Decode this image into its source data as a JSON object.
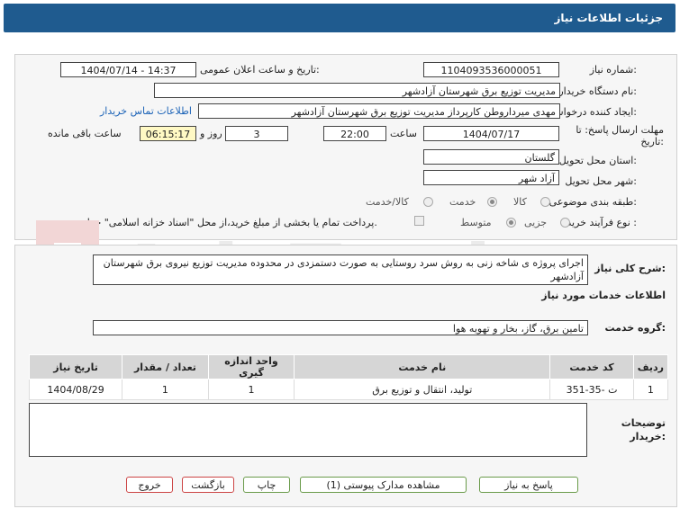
{
  "title": "جزئیات اطلاعات نیاز",
  "fields": {
    "need_number_label": "شماره نیاز:",
    "need_number": "1104093536000051",
    "announce_label": "تاریخ و ساعت اعلان عمومی:",
    "announce_value": "1404/07/14 - 14:37",
    "buyer_org_label": "نام دستگاه خریدار:",
    "buyer_org": "مدیریت توزیع برق شهرستان آزادشهر",
    "creator_label": "ایجاد کننده درخواست:",
    "creator": "مهدی میرداروطن کارپرداز مدیریت توزیع برق شهرستان آزادشهر",
    "contact_link": "اطلاعات تماس خریدار",
    "deadline_label": "مهلت ارسال پاسخ: تا تاریخ:",
    "deadline_date": "1404/07/17",
    "time_label": "ساعت",
    "deadline_time": "22:00",
    "days_value": "3",
    "days_label": "روز و",
    "remaining_time": "06:15:17",
    "remaining_label": "ساعت باقی مانده",
    "province_label": "استان محل تحویل:",
    "province": "گلستان",
    "city_label": "شهر محل تحویل:",
    "city": "آزاد شهر",
    "category_label": "طبقه بندی موضوعی:",
    "category_options": [
      "کالا",
      "خدمت",
      "کالا/خدمت"
    ],
    "category_selected": "خدمت",
    "purchase_type_label": "نوع فرآیند خرید :",
    "purchase_options": [
      "جزیی",
      "متوسط"
    ],
    "purchase_selected": "متوسط",
    "payment_note": "پرداخت تمام یا بخشی از مبلغ خرید،از محل \"اسناد خزانه اسلامی\" خواهد بود."
  },
  "need": {
    "desc_label": "شرح کلی نیاز:",
    "desc": "اجرای پروژه ی شاخه زنی به روش سرد روستایی به صورت دستمزدی در محدوده مدیریت توزیع نیروی برق شهرستان آزادشهر",
    "services_header": "اطلاعات خدمات مورد نیاز",
    "service_group_label": "گروه خدمت:",
    "service_group": "تامین برق، گاز، بخار و تهویه هوا"
  },
  "table": {
    "headers": [
      "ردیف",
      "کد خدمت",
      "نام خدمت",
      "واحد اندازه گیری",
      "تعداد / مقدار",
      "تاریخ نیاز"
    ],
    "rows": [
      [
        "1",
        "ت -35-351",
        "تولید، انتقال و توزیع برق",
        "1",
        "1",
        "1404/08/29"
      ]
    ]
  },
  "buyer_notes_label": "توضیحات خریدار:",
  "buttons": {
    "reply": "پاسخ به نیاز",
    "attachments": "مشاهده مدارک پیوستی (1)",
    "print": "چاپ",
    "back": "بازگشت",
    "exit": "خروج"
  },
  "colors": {
    "header": "#1f5b8f",
    "link": "#1c63b7"
  },
  "watermark": "AriaTender.net"
}
